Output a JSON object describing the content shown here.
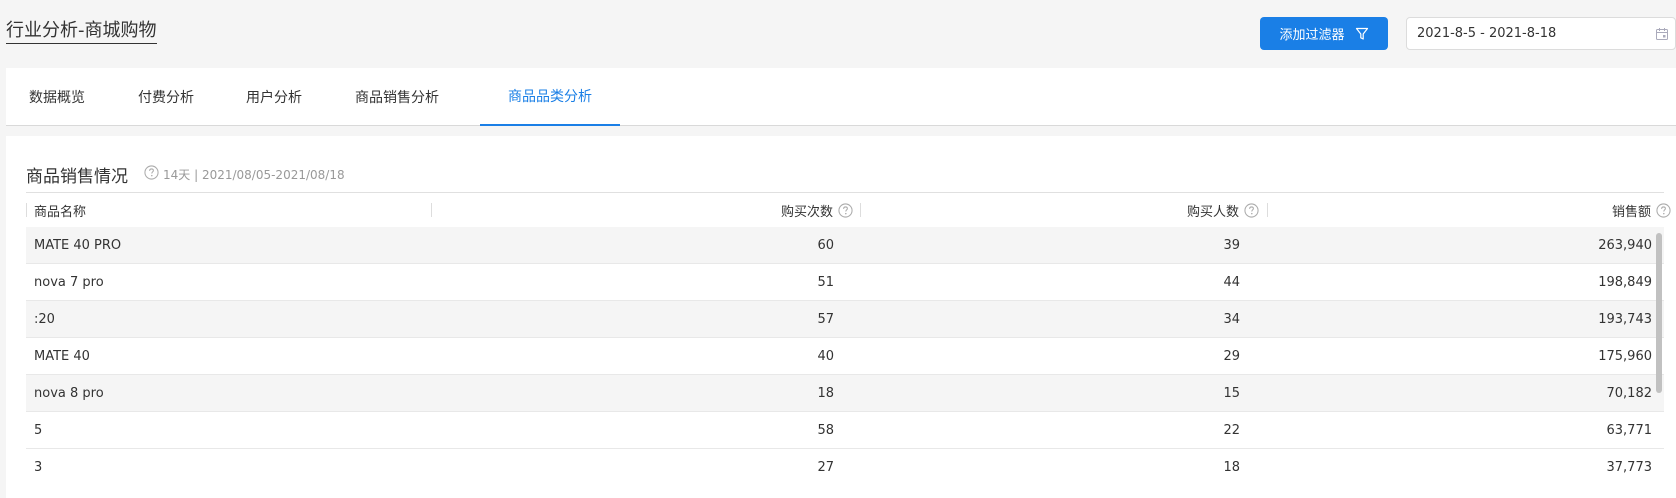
{
  "header": {
    "title": "行业分析-商城购物",
    "filter_button_label": "添加过滤器",
    "date_range": "2021-8-5 - 2021-8-18"
  },
  "tabs": [
    {
      "label": "数据概览"
    },
    {
      "label": "付费分析"
    },
    {
      "label": "用户分析"
    },
    {
      "label": "商品销售分析"
    },
    {
      "label": "商品品类分析",
      "active": true
    }
  ],
  "section": {
    "title": "商品销售情况",
    "subtitle": "14天 | 2021/08/05-2021/08/18"
  },
  "table": {
    "columns": [
      "商品名称",
      "购买次数",
      "购买人数",
      "销售额"
    ],
    "rows": [
      [
        "MATE 40 PRO",
        "60",
        "39",
        "263,940"
      ],
      [
        "nova 7 pro",
        "51",
        "44",
        "198,849"
      ],
      [
        ":20",
        "57",
        "34",
        "193,743"
      ],
      [
        "MATE 40",
        "40",
        "29",
        "175,960"
      ],
      [
        "nova 8 pro",
        "18",
        "15",
        "70,182"
      ],
      [
        "5",
        "58",
        "22",
        "63,771"
      ],
      [
        "3",
        "27",
        "18",
        "37,773"
      ]
    ]
  },
  "icons": {
    "filter": "funnel-icon",
    "calendar": "calendar-icon",
    "help": "question-circle-icon"
  },
  "colors": {
    "accent": "#1a7fe6",
    "stripe": "#f5f5f5"
  }
}
